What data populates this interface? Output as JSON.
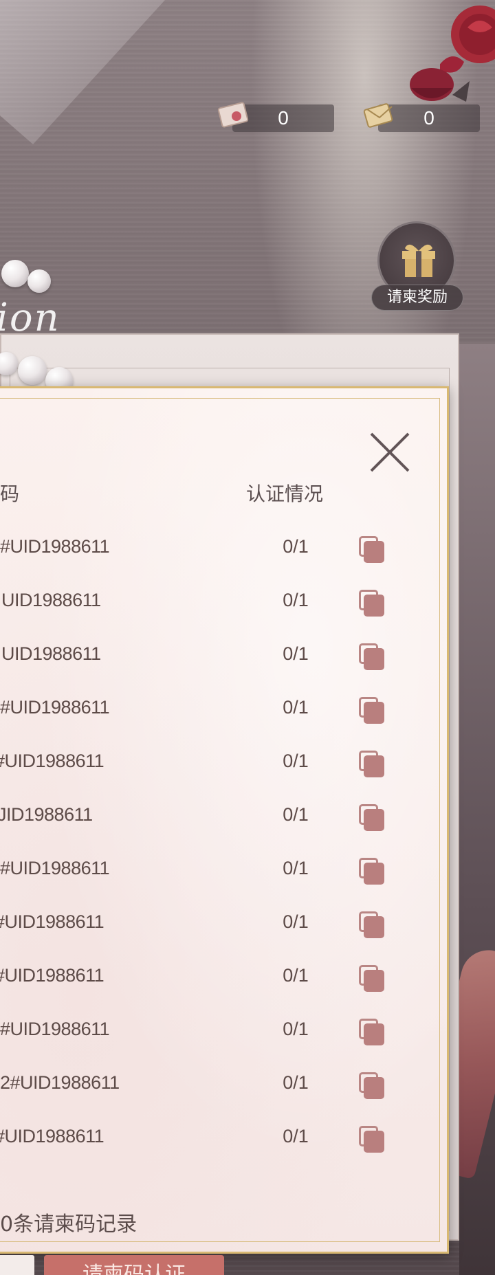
{
  "currencies": [
    {
      "icon": "letter-stamp-icon",
      "value": "0"
    },
    {
      "icon": "envelope-gold-icon",
      "value": "0"
    }
  ],
  "gift_button": {
    "icon": "gift-box-icon",
    "label": "请柬奖励"
  },
  "background": {
    "script_text": "ion"
  },
  "modal": {
    "close_icon": "close-icon",
    "columns": {
      "code": "码",
      "status": "认证情况"
    },
    "rows": [
      {
        "code": "#UID1988611",
        "status": "0/1"
      },
      {
        "code": "UID1988611",
        "status": "0/1"
      },
      {
        "code": "UID1988611",
        "status": "0/1"
      },
      {
        "code": "#UID1988611",
        "status": "0/1"
      },
      {
        "code": "#UID1988611",
        "status": "0/1"
      },
      {
        "code": "JID1988611",
        "status": "0/1"
      },
      {
        "code": "#UID1988611",
        "status": "0/1"
      },
      {
        "code": "#UID1988611",
        "status": "0/1"
      },
      {
        "code": "#UID1988611",
        "status": "0/1"
      },
      {
        "code": "#UID1988611",
        "status": "0/1"
      },
      {
        "code": "2#UID1988611",
        "status": "0/1"
      },
      {
        "code": "#UID1988611",
        "status": "0/1"
      }
    ],
    "footer_text": "0条请柬码记录",
    "primary_button_label": "请柬码认证"
  },
  "colors": {
    "accent_rose": "#b97f7e",
    "button_red": "#c6706a",
    "gold_border": "#d8b872"
  }
}
